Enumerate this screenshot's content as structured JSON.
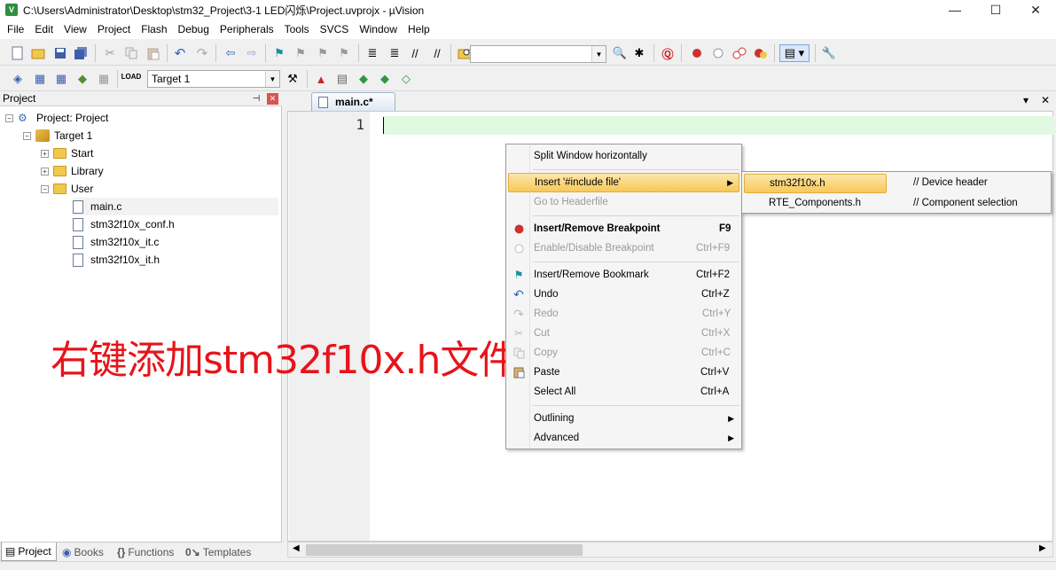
{
  "window": {
    "title": "C:\\Users\\Administrator\\Desktop\\stm32_Project\\3-1 LED闪烁\\Project.uvprojx - µVision",
    "app_icon_text": "V",
    "controls": {
      "minimize": "—",
      "maximize": "☐",
      "close": "✕"
    }
  },
  "menubar": [
    "File",
    "Edit",
    "View",
    "Project",
    "Flash",
    "Debug",
    "Peripherals",
    "Tools",
    "SVCS",
    "Window",
    "Help"
  ],
  "toolbar2": {
    "target_select": "Target 1"
  },
  "project_panel": {
    "header": "Project",
    "pin_icon": "pin-icon",
    "close_label": "✕",
    "tree": {
      "root": "Project: Project",
      "target": "Target 1",
      "groups": [
        "Start",
        "Library",
        "User"
      ],
      "files": [
        "main.c",
        "stm32f10x_conf.h",
        "stm32f10x_it.c",
        "stm32f10x_it.h"
      ]
    },
    "expand_symbols": {
      "expanded": "−",
      "collapsed": "+"
    },
    "bottom_tabs": [
      "Project",
      "Books",
      "Functions",
      "Templates"
    ]
  },
  "editor": {
    "tab": "main.c*",
    "line_number": "1",
    "tab_controls": {
      "dropdown": "▾",
      "close": "✕"
    }
  },
  "annotation": "右键添加stm32f10x.h文件",
  "context_menu": {
    "items": [
      {
        "label": "Split Window horizontally",
        "shortcut": "",
        "enabled": true
      },
      {
        "label": "Insert '#include file'",
        "shortcut": "",
        "enabled": true,
        "submenu": true,
        "highlighted": true
      },
      {
        "label": "Go to Headerfile",
        "shortcut": "",
        "enabled": false
      },
      {
        "label": "Insert/Remove Breakpoint",
        "shortcut": "F9",
        "enabled": true,
        "bold": true
      },
      {
        "label": "Enable/Disable Breakpoint",
        "shortcut": "Ctrl+F9",
        "enabled": false
      },
      {
        "label": "Insert/Remove Bookmark",
        "shortcut": "Ctrl+F2",
        "enabled": true
      },
      {
        "label": "Undo",
        "shortcut": "Ctrl+Z",
        "enabled": true
      },
      {
        "label": "Redo",
        "shortcut": "Ctrl+Y",
        "enabled": false
      },
      {
        "label": "Cut",
        "shortcut": "Ctrl+X",
        "enabled": false
      },
      {
        "label": "Copy",
        "shortcut": "Ctrl+C",
        "enabled": false
      },
      {
        "label": "Paste",
        "shortcut": "Ctrl+V",
        "enabled": true
      },
      {
        "label": "Select All",
        "shortcut": "Ctrl+A",
        "enabled": true
      },
      {
        "label": "Outlining",
        "shortcut": "",
        "enabled": true,
        "submenu": true
      },
      {
        "label": "Advanced",
        "shortcut": "",
        "enabled": true,
        "submenu": true
      }
    ],
    "submenu_arrow": "▶"
  },
  "include_submenu": {
    "items": [
      {
        "file": "stm32f10x.h",
        "comment": "// Device header",
        "highlighted": true
      },
      {
        "file": "RTE_Components.h",
        "comment": "// Component selection"
      }
    ]
  },
  "icons": {
    "toolbar1": [
      "new-file-icon",
      "open-icon",
      "save-icon",
      "save-all-icon",
      "cut-icon",
      "copy-icon",
      "paste-icon",
      "undo-icon",
      "redo-icon",
      "nav-back-icon",
      "nav-forward-icon",
      "bookmark-icon",
      "prev-bookmark-icon",
      "next-bookmark-icon",
      "clear-bookmarks-icon",
      "indent-icon",
      "unindent-icon",
      "comment-icon",
      "uncomment-icon",
      "find-in-files-icon",
      "find-icon",
      "incremental-find-icon",
      "debug-session-icon",
      "breakpoint-icon",
      "disable-breakpoint-icon",
      "disable-all-breakpoints-icon",
      "kill-breakpoints-icon",
      "window-layout-icon",
      "configure-icon"
    ],
    "toolbar2": [
      "translate-icon",
      "build-icon",
      "rebuild-icon",
      "batch-build-icon",
      "stop-build-icon",
      "download-icon",
      "target-options-icon",
      "manage-components-icon",
      "select-packs-icon",
      "run-time-env-icon",
      "pack-installer-icon",
      "book-icon"
    ]
  },
  "colors": {
    "current_line": "#e0f9e0",
    "menu_highlight": "#f7c85b",
    "annotation": "#e8131b",
    "breakpoint_red": "#d0312d"
  }
}
